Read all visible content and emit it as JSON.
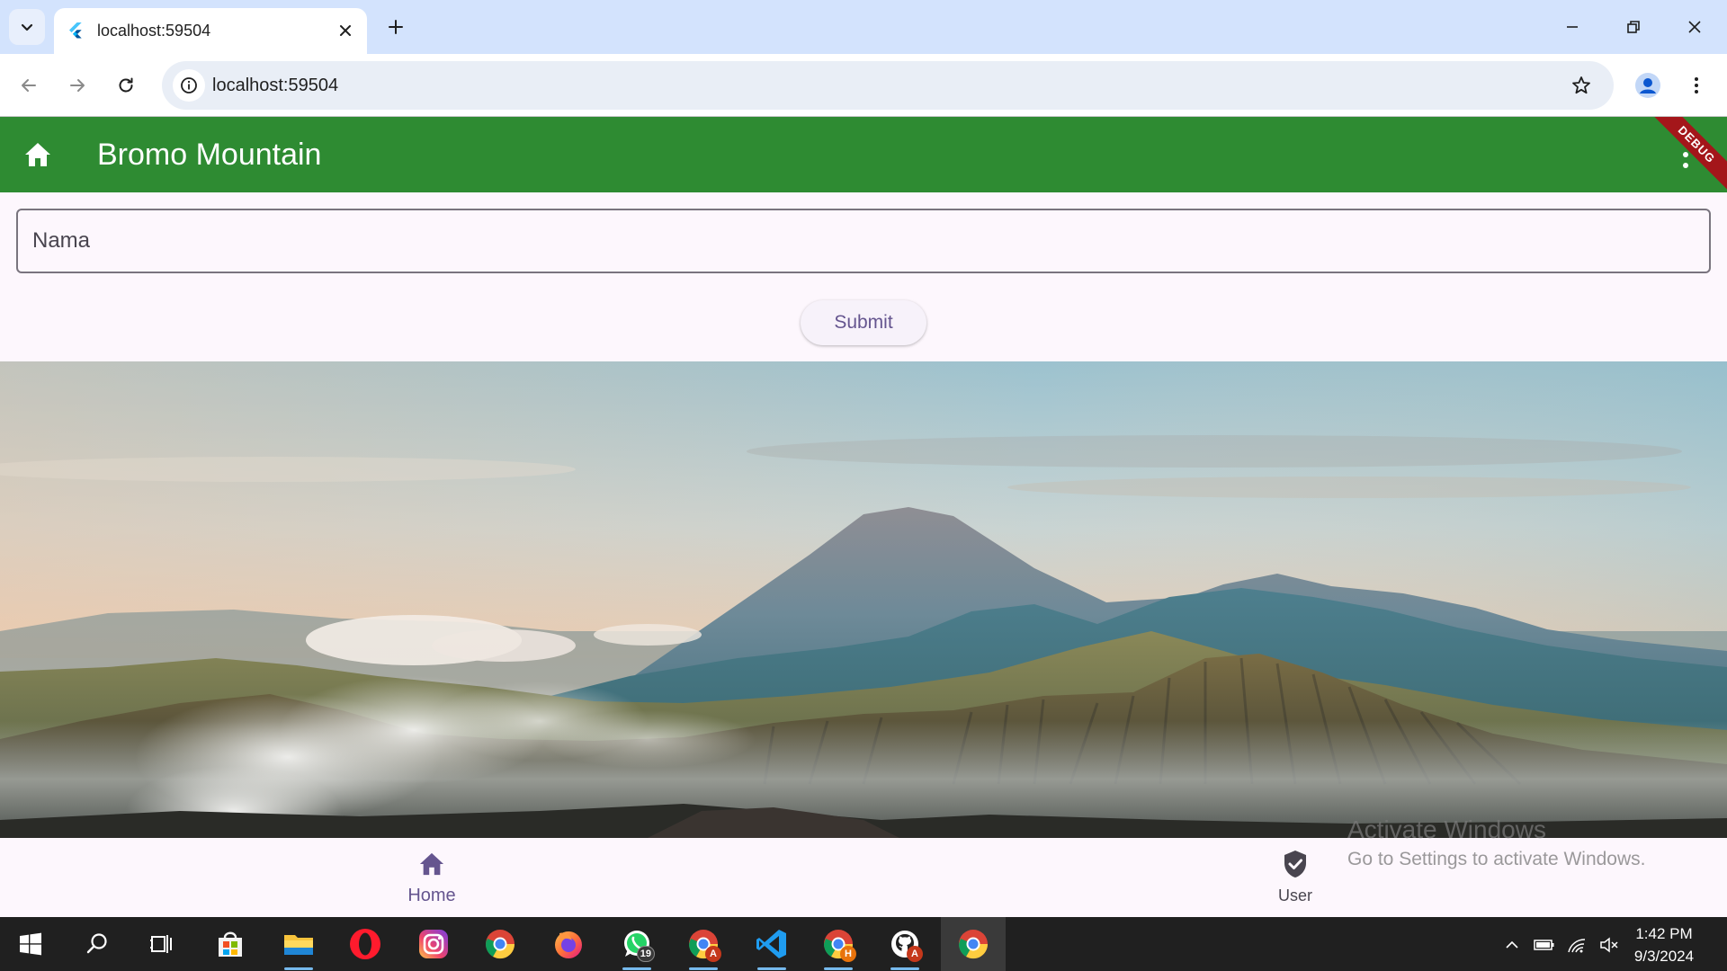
{
  "browser": {
    "tab_title": "localhost:59504",
    "address": "localhost:59504"
  },
  "app": {
    "title": "Bromo Mountain",
    "debug_banner": "DEBUG",
    "name_field": {
      "placeholder": "Nama",
      "value": ""
    },
    "submit_label": "Submit",
    "bottom_nav": [
      {
        "label": "Home",
        "icon": "home-icon",
        "selected": true
      },
      {
        "label": "User",
        "icon": "verified-user-icon",
        "selected": false
      }
    ],
    "colors": {
      "appbar": "#2e8b32",
      "accent": "#65558f",
      "background": "#fdf7fd"
    }
  },
  "watermark": {
    "title": "Activate Windows",
    "subtitle": "Go to Settings to activate Windows."
  },
  "taskbar": {
    "apps": [
      {
        "name": "start-icon"
      },
      {
        "name": "search-icon"
      },
      {
        "name": "task-view-icon"
      },
      {
        "name": "microsoft-store-icon"
      },
      {
        "name": "file-explorer-icon"
      },
      {
        "name": "opera-icon"
      },
      {
        "name": "instagram-icon"
      },
      {
        "name": "chrome-icon"
      },
      {
        "name": "firefox-icon"
      },
      {
        "name": "whatsapp-icon",
        "badge": "19"
      },
      {
        "name": "chrome-profile-icon",
        "badge": "A"
      },
      {
        "name": "vscode-icon"
      },
      {
        "name": "chrome-profile-icon",
        "badge": "H"
      },
      {
        "name": "github-desktop-icon",
        "badge": "A"
      },
      {
        "name": "chrome-icon"
      }
    ],
    "time": "1:42 PM",
    "date": "9/3/2024"
  }
}
